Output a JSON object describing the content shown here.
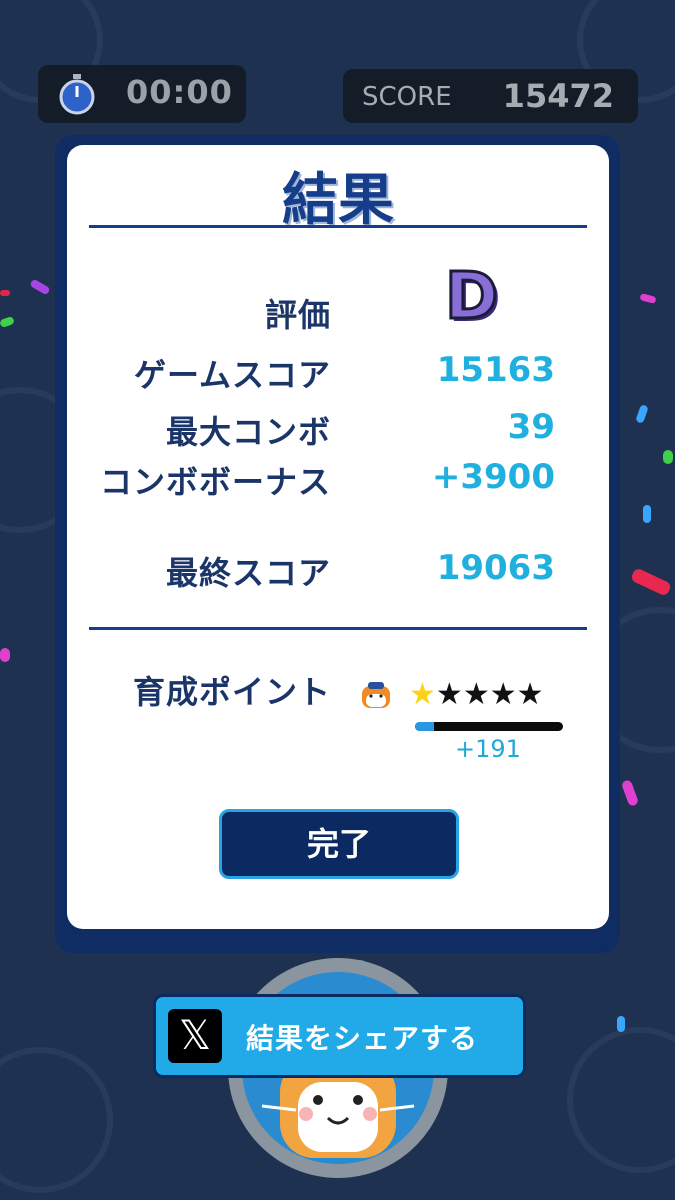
{
  "hud": {
    "timer": "00:00",
    "score_label": "SCORE",
    "score_value": "15472"
  },
  "results": {
    "title": "結果",
    "grade_label": "評価",
    "grade": "D",
    "rows": [
      {
        "label": "ゲームスコア",
        "value": "15163"
      },
      {
        "label": "最大コンボ",
        "value": "39"
      },
      {
        "label": "コンボボーナス",
        "value": "+3900"
      },
      {
        "label": "最終スコア",
        "value": "19063"
      }
    ],
    "training": {
      "label": "育成ポイント",
      "stars_total": 5,
      "stars_filled": 1,
      "progress_fraction": 0.13,
      "bonus": "+191"
    },
    "done_label": "完了"
  },
  "share": {
    "x_glyph": "𝕏",
    "label": "結果をシェアする"
  },
  "colors": {
    "background": "#1f3150",
    "panel_border": "#0f2c63",
    "label_navy": "#1b3568",
    "value_cyan": "#20b0e0",
    "button_blue": "#21a9e8"
  }
}
